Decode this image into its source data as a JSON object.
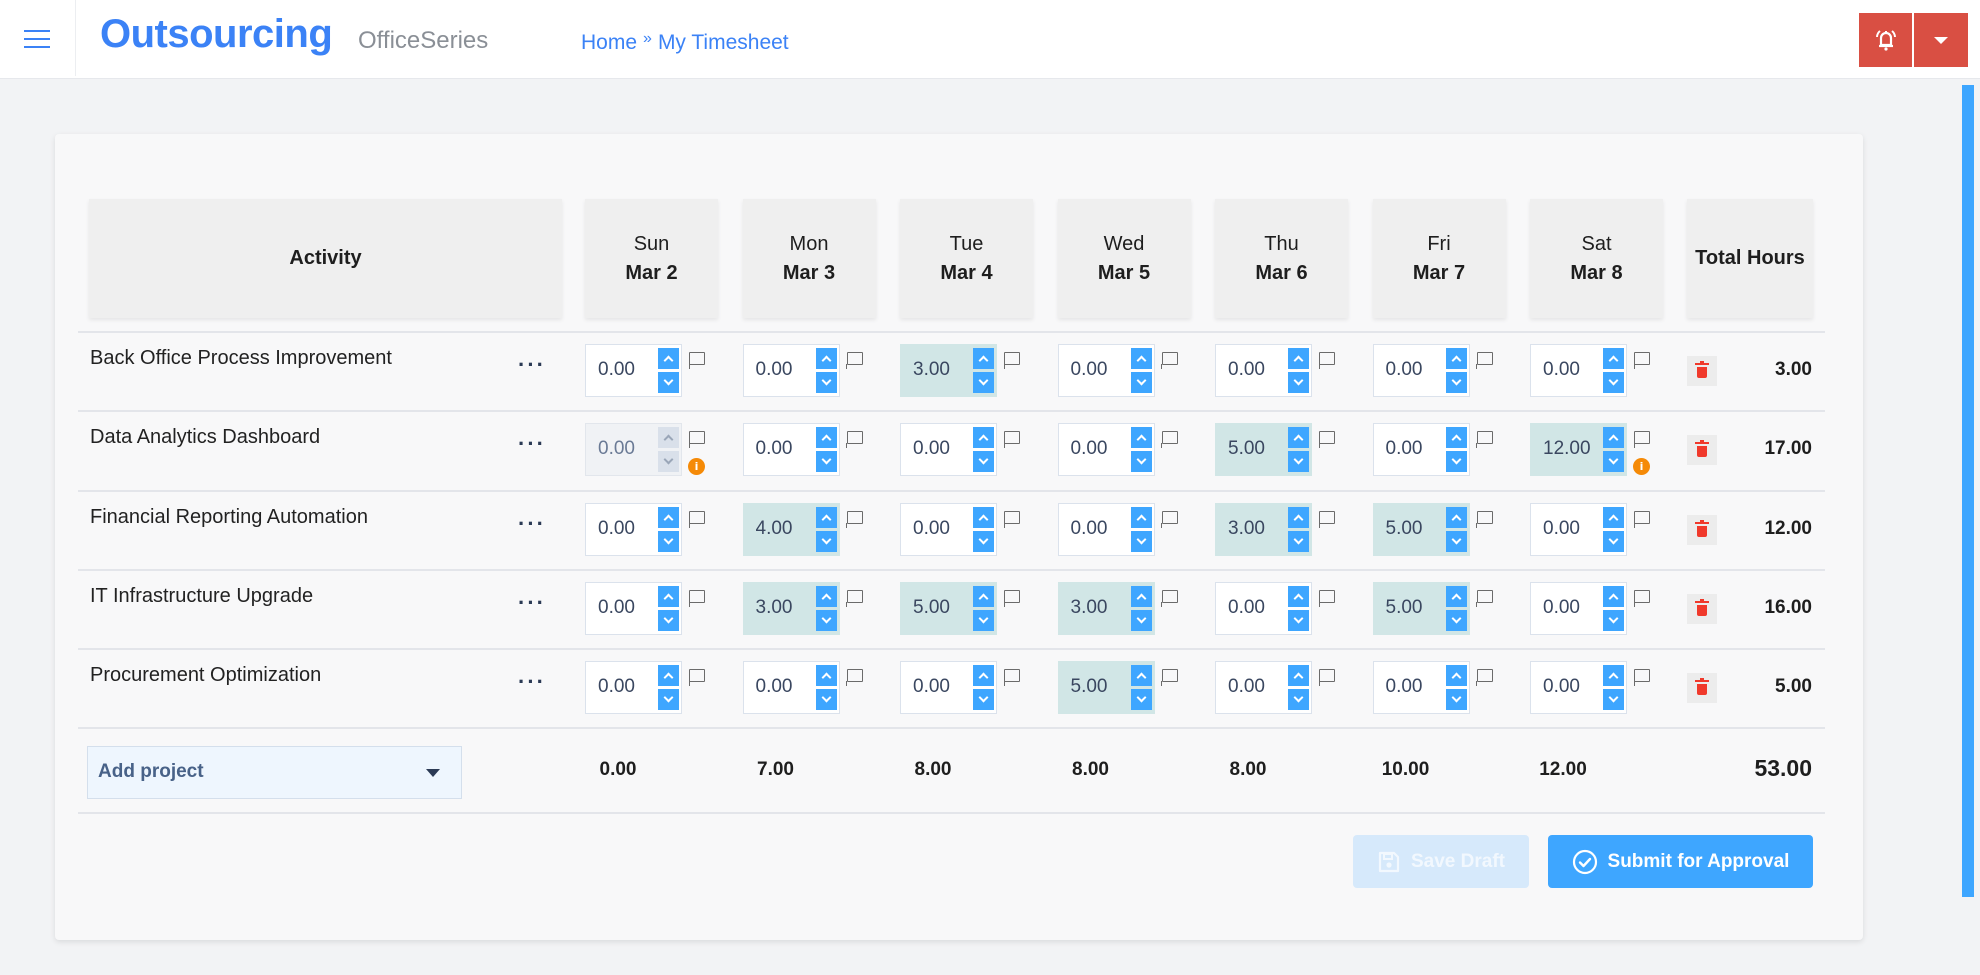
{
  "header": {
    "brand": "Outsourcing",
    "brand_sub": "OfficeSeries",
    "breadcrumb": [
      {
        "label": "Home"
      },
      {
        "label": "My Timesheet"
      }
    ],
    "breadcrumb_separator": "»",
    "alert_color": "#d94f43"
  },
  "table": {
    "activity_header": "Activity",
    "total_header": "Total Hours",
    "days": [
      {
        "dow": "Sun",
        "date": "Mar 2"
      },
      {
        "dow": "Mon",
        "date": "Mar 3"
      },
      {
        "dow": "Tue",
        "date": "Mar 4"
      },
      {
        "dow": "Wed",
        "date": "Mar 5"
      },
      {
        "dow": "Thu",
        "date": "Mar 6"
      },
      {
        "dow": "Fri",
        "date": "Mar 7"
      },
      {
        "dow": "Sat",
        "date": "Mar 8"
      }
    ],
    "rows": [
      {
        "name": "Back Office Process Improvement",
        "hours": [
          "0.00",
          "0.00",
          "3.00",
          "0.00",
          "0.00",
          "0.00",
          "0.00"
        ],
        "total": "3.00"
      },
      {
        "name": "Data Analytics Dashboard",
        "hours": [
          "0.00",
          "0.00",
          "0.00",
          "0.00",
          "5.00",
          "0.00",
          "12.00"
        ],
        "total": "17.00",
        "disabled_days": [
          0
        ],
        "info_days": [
          0,
          6
        ]
      },
      {
        "name": "Financial Reporting Automation",
        "hours": [
          "0.00",
          "4.00",
          "0.00",
          "0.00",
          "3.00",
          "5.00",
          "0.00"
        ],
        "total": "12.00"
      },
      {
        "name": "IT Infrastructure Upgrade",
        "hours": [
          "0.00",
          "3.00",
          "5.00",
          "3.00",
          "0.00",
          "5.00",
          "0.00"
        ],
        "total": "16.00"
      },
      {
        "name": "Procurement Optimization",
        "hours": [
          "0.00",
          "0.00",
          "0.00",
          "5.00",
          "0.00",
          "0.00",
          "0.00"
        ],
        "total": "5.00"
      }
    ],
    "row_menu_label": "···",
    "add_project_label": "Add project",
    "day_totals": [
      "0.00",
      "7.00",
      "8.00",
      "8.00",
      "8.00",
      "10.00",
      "12.00"
    ],
    "grand_total": "53.00",
    "info_glyph": "i"
  },
  "actions": {
    "save_draft": "Save Draft",
    "save_draft_disabled": true,
    "submit": "Submit for Approval"
  },
  "colors": {
    "accent": "#3b82f6",
    "spinner": "#3ea6ff",
    "filled_cell": "#d1e6e6",
    "delete": "#f0392b",
    "warning": "#f58a07"
  }
}
